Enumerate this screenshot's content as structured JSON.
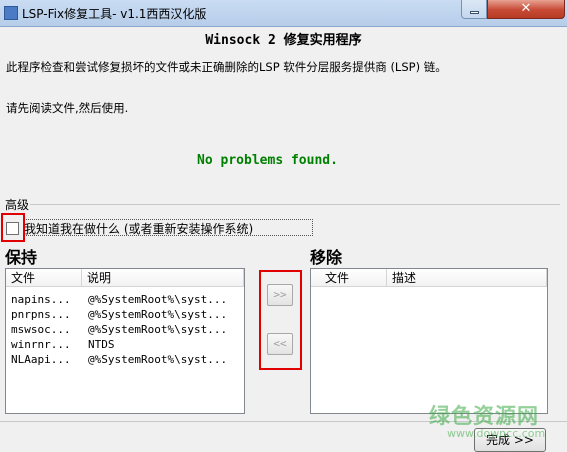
{
  "window": {
    "title": "LSP-Fix修复工具- v1.1西西汉化版",
    "close_glyph": "✕"
  },
  "heading": "Winsock 2 修复实用程序",
  "description": "此程序检查和尝试修复损坏的文件或未正确删除的LSP 软件分层服务提供商 (LSP) 链。",
  "instruction": "请先阅读文件,然后使用.",
  "status": "No problems found.",
  "advanced": {
    "label": "高级",
    "checkbox_label": "我知道我在做什么 (或者重新安装操作系统)",
    "checked": false
  },
  "keep": {
    "title": "保持",
    "columns": [
      "文件",
      "说明"
    ],
    "rows": [
      {
        "file": "napins...",
        "desc": "@%SystemRoot%\\syst..."
      },
      {
        "file": "pnrpns...",
        "desc": "@%SystemRoot%\\syst..."
      },
      {
        "file": "mswsoc...",
        "desc": "@%SystemRoot%\\syst..."
      },
      {
        "file": "winrnr...",
        "desc": "NTDS"
      },
      {
        "file": "NLAapi...",
        "desc": "@%SystemRoot%\\syst..."
      }
    ]
  },
  "remove": {
    "title": "移除",
    "columns": [
      "文件",
      "描述"
    ],
    "rows": []
  },
  "buttons": {
    "move_right": ">>",
    "move_left": "<<",
    "finish": "完成 >>"
  },
  "watermark": {
    "cn": "绿色资源网",
    "en": "www.downcc.com"
  }
}
